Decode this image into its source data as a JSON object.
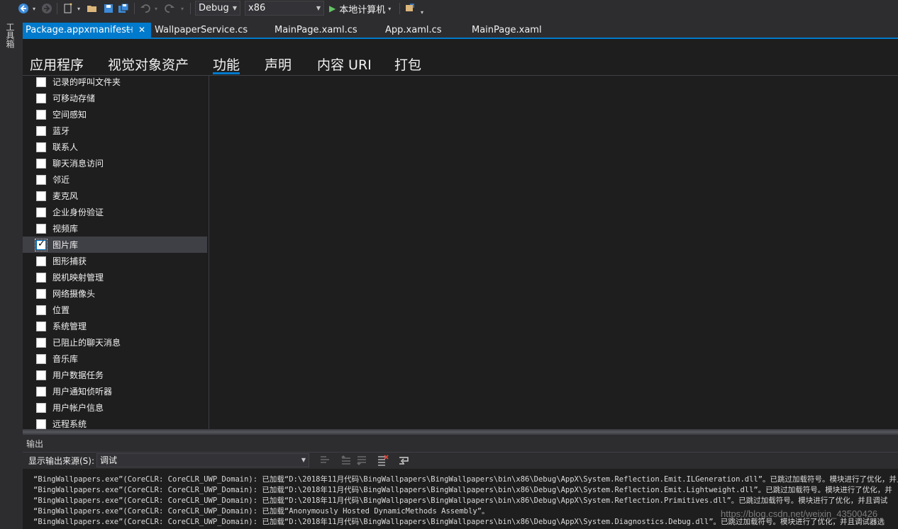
{
  "toolbar": {
    "config": "Debug",
    "platform": "x86",
    "run_target": "本地计算机"
  },
  "leftstrip": {
    "toolbox": "工具箱"
  },
  "doc_tabs": [
    {
      "label": "Package.appxmanifest",
      "active": true
    },
    {
      "label": "WallpaperService.cs",
      "active": false
    },
    {
      "label": "MainPage.xaml.cs",
      "active": false
    },
    {
      "label": "App.xaml.cs",
      "active": false
    },
    {
      "label": "MainPage.xaml",
      "active": false
    }
  ],
  "section_tabs": [
    {
      "label": "应用程序"
    },
    {
      "label": "视觉对象资产"
    },
    {
      "label": "功能",
      "active": true
    },
    {
      "label": "声明"
    },
    {
      "label": "内容 URI"
    },
    {
      "label": "打包"
    }
  ],
  "capabilities": [
    {
      "label": "记录的呼叫文件夹",
      "checked": false
    },
    {
      "label": "可移动存储",
      "checked": false
    },
    {
      "label": "空间感知",
      "checked": false
    },
    {
      "label": "蓝牙",
      "checked": false
    },
    {
      "label": "联系人",
      "checked": false
    },
    {
      "label": "聊天消息访问",
      "checked": false
    },
    {
      "label": "邻近",
      "checked": false
    },
    {
      "label": "麦克风",
      "checked": false
    },
    {
      "label": "企业身份验证",
      "checked": false
    },
    {
      "label": "视频库",
      "checked": false
    },
    {
      "label": "图片库",
      "checked": true
    },
    {
      "label": "图形捕获",
      "checked": false
    },
    {
      "label": "脱机映射管理",
      "checked": false
    },
    {
      "label": "网络摄像头",
      "checked": false
    },
    {
      "label": "位置",
      "checked": false
    },
    {
      "label": "系统管理",
      "checked": false
    },
    {
      "label": "已阻止的聊天消息",
      "checked": false
    },
    {
      "label": "音乐库",
      "checked": false
    },
    {
      "label": "用户数据任务",
      "checked": false
    },
    {
      "label": "用户通知侦听器",
      "checked": false
    },
    {
      "label": "用户帐户信息",
      "checked": false
    },
    {
      "label": "远程系统",
      "checked": false
    }
  ],
  "output": {
    "title": "输出",
    "source_label": "显示输出来源(S):",
    "source_value": "调试",
    "lines": [
      "“BingWallpapers.exe”(CoreCLR: CoreCLR_UWP_Domain): 已加载“D:\\2018年11月代码\\BingWallpapers\\BingWallpapers\\bin\\x86\\Debug\\AppX\\System.Reflection.Emit.ILGeneration.dll”。已跳过加载符号。模块进行了优化，并且调试器选",
      "“BingWallpapers.exe”(CoreCLR: CoreCLR_UWP_Domain): 已加载“D:\\2018年11月代码\\BingWallpapers\\BingWallpapers\\bin\\x86\\Debug\\AppX\\System.Reflection.Emit.Lightweight.dll”。已跳过加载符号。模块进行了优化，并",
      "“BingWallpapers.exe”(CoreCLR: CoreCLR_UWP_Domain): 已加载“D:\\2018年11月代码\\BingWallpapers\\BingWallpapers\\bin\\x86\\Debug\\AppX\\System.Reflection.Primitives.dll”。已跳过加载符号。模块进行了优化，并且调试",
      "“BingWallpapers.exe”(CoreCLR: CoreCLR_UWP_Domain): 已加载“Anonymously Hosted DynamicMethods Assembly”。",
      "“BingWallpapers.exe”(CoreCLR: CoreCLR_UWP_Domain): 已加载“D:\\2018年11月代码\\BingWallpapers\\BingWallpapers\\bin\\x86\\Debug\\AppX\\System.Diagnostics.Debug.dll”。已跳过加载符号。模块进行了优化，并且调试器选"
    ],
    "watermark": "https://blog.csdn.net/weixin_43500426"
  }
}
